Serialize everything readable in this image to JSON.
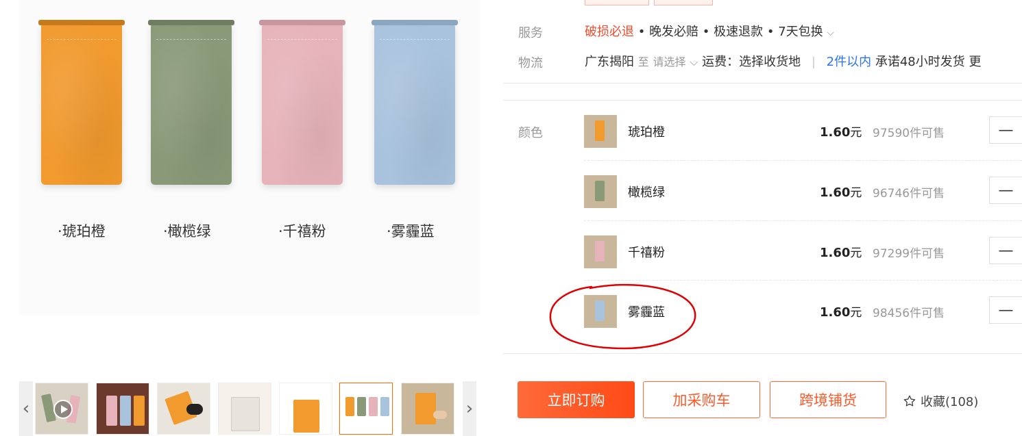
{
  "gallery": {
    "main_labels": [
      "·琥珀橙",
      "·橄榄绿",
      "·千禧粉",
      "·雾霾蓝"
    ],
    "pouch_colors": [
      "#f19a2e",
      "#8a9a78",
      "#e7b3ba",
      "#a9c3dd"
    ],
    "thumb_prev_icon": "‹",
    "thumb_next_icon": "›",
    "thumb_count": 7,
    "active_thumb_index": 5
  },
  "service": {
    "label": "服务",
    "items": [
      "破损必退",
      "晚发必赔",
      "极速退款",
      "7天包换"
    ],
    "separator": " • ",
    "chevron": "⌵"
  },
  "logistics": {
    "label": "物流",
    "origin": "广东揭阳",
    "to": "至",
    "select": "请选择",
    "chevron": "⌵",
    "shipping": "运费：选择收货地",
    "qty_link": "2件以内",
    "promise": "承诺48小时发货",
    "more": "更"
  },
  "color_section": {
    "label": "颜色",
    "skus": [
      {
        "name": "琥珀橙",
        "price": "1.60",
        "unit": "元",
        "stock": "97590件可售",
        "color": "#f19a2e"
      },
      {
        "name": "橄榄绿",
        "price": "1.60",
        "unit": "元",
        "stock": "96746件可售",
        "color": "#8a9a78"
      },
      {
        "name": "千禧粉",
        "price": "1.60",
        "unit": "元",
        "stock": "97299件可售",
        "color": "#e7b3ba"
      },
      {
        "name": "雾霾蓝",
        "price": "1.60",
        "unit": "元",
        "stock": "98456件可售",
        "color": "#a9c3dd"
      }
    ],
    "stepper_minus": "—"
  },
  "actions": {
    "buy": "立即订购",
    "cart": "加采购车",
    "cross_border": "跨境铺货",
    "favorite": "收藏(108)"
  },
  "colors": {
    "accent": "#ff5a2a",
    "link_blue": "#2a73ff",
    "annotation_red": "#e00000"
  }
}
